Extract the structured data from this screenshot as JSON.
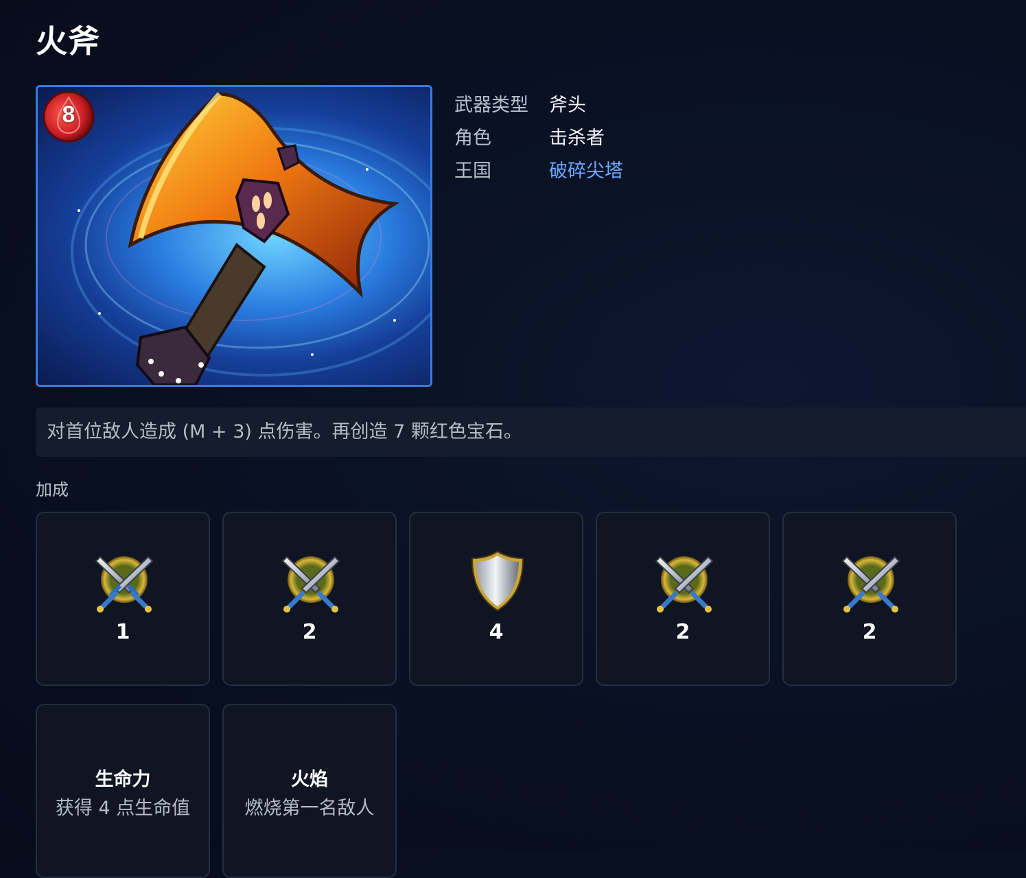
{
  "weapon": {
    "name": "火斧",
    "cost": "8",
    "image_icon": "fire-axe-art"
  },
  "properties": [
    {
      "key": "武器类型",
      "value": "斧头"
    },
    {
      "key": "角色",
      "value": "击杀者"
    },
    {
      "key": "王国",
      "value": "破碎尖塔"
    }
  ],
  "description": "对首位敌人造成 (M + 3) 点伤害。再创造 7 颗红色宝石。",
  "bonuses": {
    "label": "加成",
    "items": [
      {
        "icon": "crossed-swords-icon",
        "value": "1"
      },
      {
        "icon": "crossed-swords-icon",
        "value": "2"
      },
      {
        "icon": "shield-icon",
        "value": "4"
      },
      {
        "icon": "crossed-swords-icon",
        "value": "2"
      },
      {
        "icon": "crossed-swords-icon",
        "value": "2"
      }
    ],
    "traits": [
      {
        "name": "生命力",
        "desc": "获得 4 点生命值"
      },
      {
        "name": "火焰",
        "desc": "燃烧第一名敌人"
      }
    ]
  },
  "colors": {
    "link": "#6ea8ff",
    "frame": "#3b7be0",
    "cost_badge": "#c81e24"
  }
}
